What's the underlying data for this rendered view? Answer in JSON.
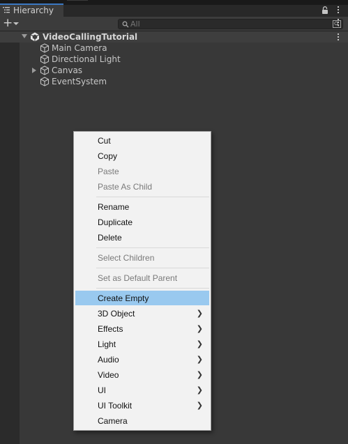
{
  "window": {
    "tab_title": "Hierarchy",
    "search_placeholder": "All"
  },
  "hierarchy": {
    "scene_name": "VideoCallingTutorial",
    "items": [
      {
        "label": "Main Camera"
      },
      {
        "label": "Directional Light"
      },
      {
        "label": "Canvas"
      },
      {
        "label": "EventSystem"
      }
    ]
  },
  "context_menu": {
    "items": [
      {
        "label": "Cut",
        "enabled": true
      },
      {
        "label": "Copy",
        "enabled": true
      },
      {
        "label": "Paste",
        "enabled": false
      },
      {
        "label": "Paste As Child",
        "enabled": false
      },
      {
        "label": "Rename",
        "enabled": true
      },
      {
        "label": "Duplicate",
        "enabled": true
      },
      {
        "label": "Delete",
        "enabled": true
      },
      {
        "label": "Select Children",
        "enabled": false
      },
      {
        "label": "Set as Default Parent",
        "enabled": false
      },
      {
        "label": "Create Empty",
        "enabled": true,
        "highlighted": true
      },
      {
        "label": "3D Object",
        "enabled": true,
        "submenu": true
      },
      {
        "label": "Effects",
        "enabled": true,
        "submenu": true
      },
      {
        "label": "Light",
        "enabled": true,
        "submenu": true
      },
      {
        "label": "Audio",
        "enabled": true,
        "submenu": true
      },
      {
        "label": "Video",
        "enabled": true,
        "submenu": true
      },
      {
        "label": "UI",
        "enabled": true,
        "submenu": true
      },
      {
        "label": "UI Toolkit",
        "enabled": true,
        "submenu": true
      },
      {
        "label": "Camera",
        "enabled": true
      }
    ]
  },
  "colors": {
    "panel_bg": "#383838",
    "menu_bg": "#f2f2f2",
    "menu_highlight": "#99c9ef",
    "tab_accent": "#3a78c3"
  }
}
